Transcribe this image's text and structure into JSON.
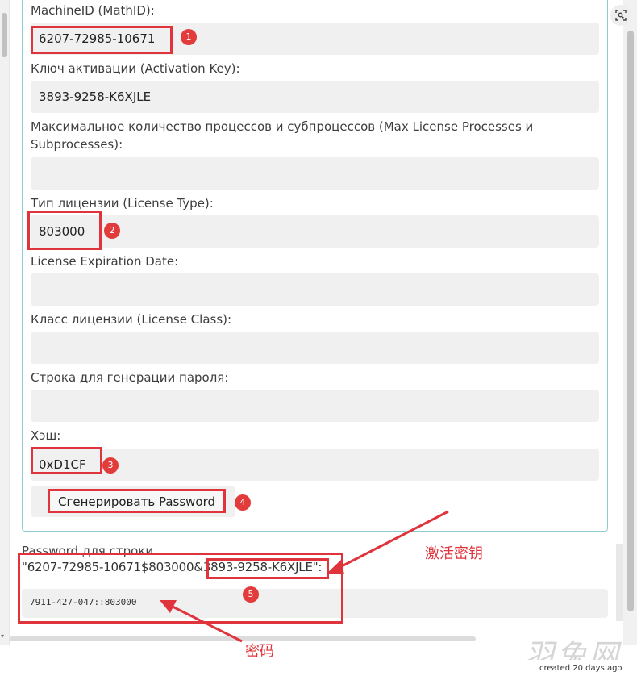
{
  "form": {
    "machine_id_label": "MachineID (MathID):",
    "machine_id_value": "6207-72985-10671",
    "activation_key_label": "Ключ активации (Activation Key):",
    "activation_key_value": "3893-9258-K6XJLE",
    "max_processes_label_line1": "Максимальное количество процессов и субпроцессов (Max License Processes и",
    "max_processes_label_line2": "Subprocesses):",
    "max_processes_value": "",
    "license_type_label": "Тип лицензии (License Type):",
    "license_type_value": "803000",
    "expiration_label": "License Expiration Date:",
    "expiration_value": "",
    "license_class_label": "Класс лицензии (License Class):",
    "license_class_value": "",
    "password_string_label": "Строка для генерации пароля:",
    "password_string_value": "",
    "hash_label": "Хэш:",
    "hash_value": "0xD1CF",
    "generate_button": "Сгенерировать Password"
  },
  "output": {
    "password_for_label": "Password для строки",
    "string_prefix": "\"6207-72985-10671$803000&",
    "string_key": "3893-9258-K6XJLE",
    "string_suffix": "\":",
    "password_value": "7911-427-047::803000"
  },
  "annotations": {
    "badges": [
      "1",
      "2",
      "3",
      "4",
      "5"
    ],
    "note_activation_key": "激活密钥",
    "note_password": "密码",
    "color": "#e0343c"
  },
  "watermark": "羽兔网",
  "footer": "created 20 days ago",
  "icons": {
    "corner": "image-search-icon"
  }
}
